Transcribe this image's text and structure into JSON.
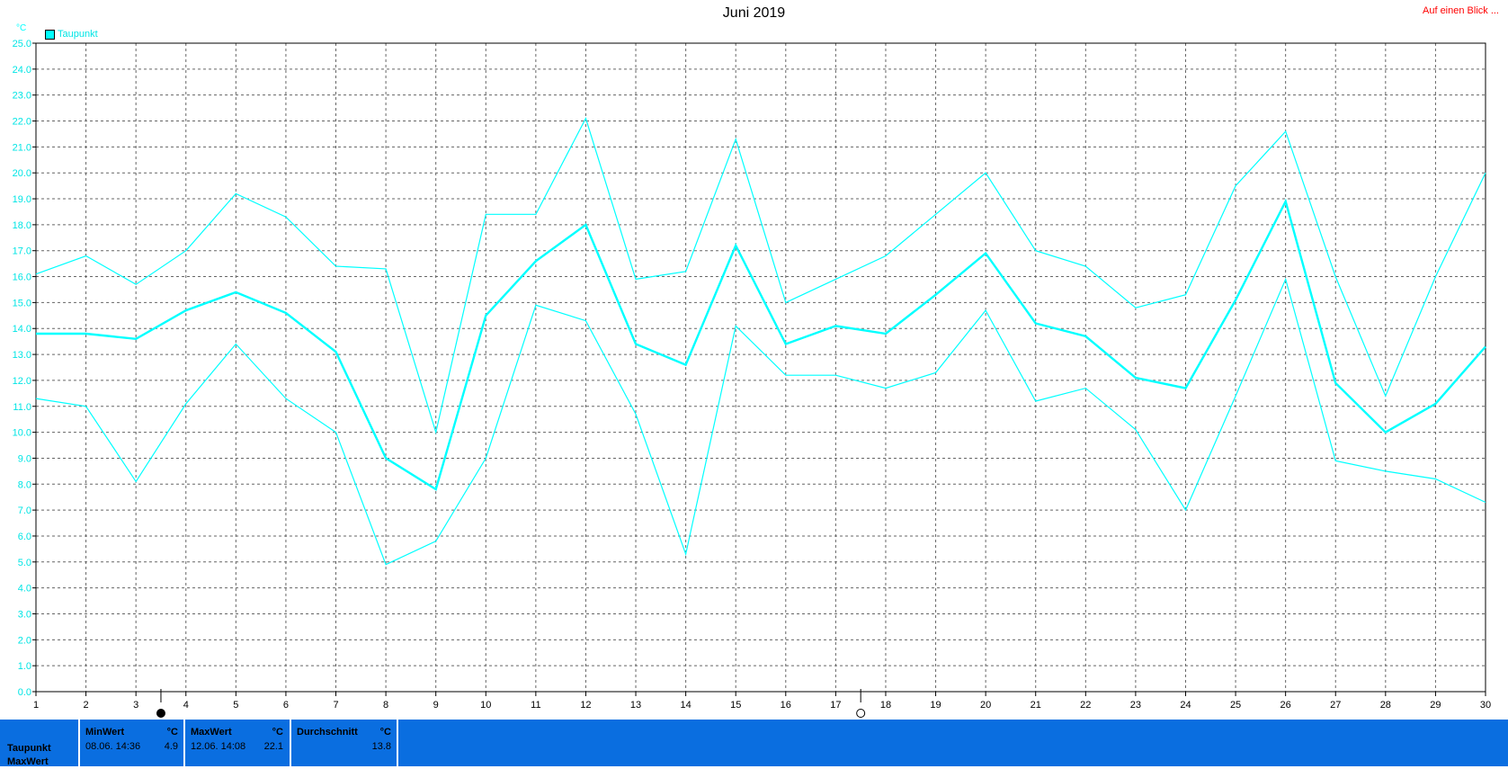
{
  "header": {
    "title": "Juni 2019",
    "link": "Auf einen Blick ..."
  },
  "chart_data": {
    "type": "line",
    "title": "Juni 2019",
    "ylabel": "°C",
    "ylim": [
      0,
      25
    ],
    "xlim": [
      1,
      30
    ],
    "grid": true,
    "legend": [
      "Taupunkt"
    ],
    "legend_position": "top-left",
    "x": [
      1,
      2,
      3,
      4,
      5,
      6,
      7,
      8,
      9,
      10,
      11,
      12,
      13,
      14,
      15,
      16,
      17,
      18,
      19,
      20,
      21,
      22,
      23,
      24,
      25,
      26,
      27,
      28,
      29,
      30
    ],
    "y_ticks": [
      "0.0",
      "1.0",
      "2.0",
      "3.0",
      "4.0",
      "5.0",
      "6.0",
      "7.0",
      "8.0",
      "9.0",
      "10.0",
      "11.0",
      "12.0",
      "13.0",
      "14.0",
      "15.0",
      "16.0",
      "17.0",
      "18.0",
      "19.0",
      "20.0",
      "21.0",
      "22.0",
      "23.0",
      "24.0",
      "25.0"
    ],
    "x_ticks": [
      "1",
      "2",
      "3",
      "4",
      "5",
      "6",
      "7",
      "8",
      "9",
      "10",
      "11",
      "12",
      "13",
      "14",
      "15",
      "16",
      "17",
      "18",
      "19",
      "20",
      "21",
      "22",
      "23",
      "24",
      "25",
      "26",
      "27",
      "28",
      "29",
      "30"
    ],
    "series": [
      {
        "role": "max",
        "color": "#00ffff",
        "values": [
          16.1,
          16.8,
          15.7,
          17.0,
          19.2,
          18.3,
          16.4,
          16.3,
          10.0,
          18.4,
          18.4,
          22.1,
          15.9,
          16.2,
          21.3,
          15.0,
          15.9,
          16.8,
          18.4,
          20.0,
          17.0,
          16.4,
          14.8,
          15.3,
          19.5,
          21.6,
          16.0,
          11.4,
          16.0,
          20.0
        ]
      },
      {
        "role": "average",
        "color": "#00ffff",
        "values": [
          13.8,
          13.8,
          13.6,
          14.7,
          15.4,
          14.6,
          13.1,
          9.0,
          7.8,
          14.5,
          16.6,
          18.0,
          13.4,
          12.6,
          17.2,
          13.4,
          14.1,
          13.8,
          15.3,
          16.9,
          14.2,
          13.7,
          12.1,
          11.7,
          15.1,
          18.9,
          11.9,
          10.0,
          11.1,
          13.3
        ]
      },
      {
        "role": "min",
        "color": "#00ffff",
        "values": [
          11.3,
          11.0,
          8.1,
          11.1,
          13.4,
          11.3,
          10.0,
          4.9,
          5.8,
          9.0,
          14.9,
          14.3,
          10.7,
          5.3,
          14.1,
          12.2,
          12.2,
          11.7,
          12.3,
          14.7,
          11.2,
          11.7,
          10.1,
          7.0,
          11.4,
          15.9,
          8.9,
          8.5,
          8.2,
          7.3
        ]
      }
    ],
    "markers": [
      {
        "x": 3.5,
        "icon": "full-moon"
      },
      {
        "x": 17.5,
        "icon": "new-moon"
      }
    ]
  },
  "axis": {
    "unit": "°C"
  },
  "legend": {
    "label": "Taupunkt",
    "color": "#00ffff"
  },
  "info": {
    "row_labels": [
      "Taupunkt",
      "MaxWert"
    ],
    "min": {
      "header": "MinWert",
      "unit": "°C",
      "timestamp": "08.06.  14:36",
      "value": "4.9"
    },
    "max": {
      "header": "MaxWert",
      "unit": "°C",
      "timestamp": "12.06.  14:08",
      "value": "22.1"
    },
    "avg": {
      "header": "Durchschnitt",
      "unit": "°C",
      "value": "13.8"
    }
  }
}
